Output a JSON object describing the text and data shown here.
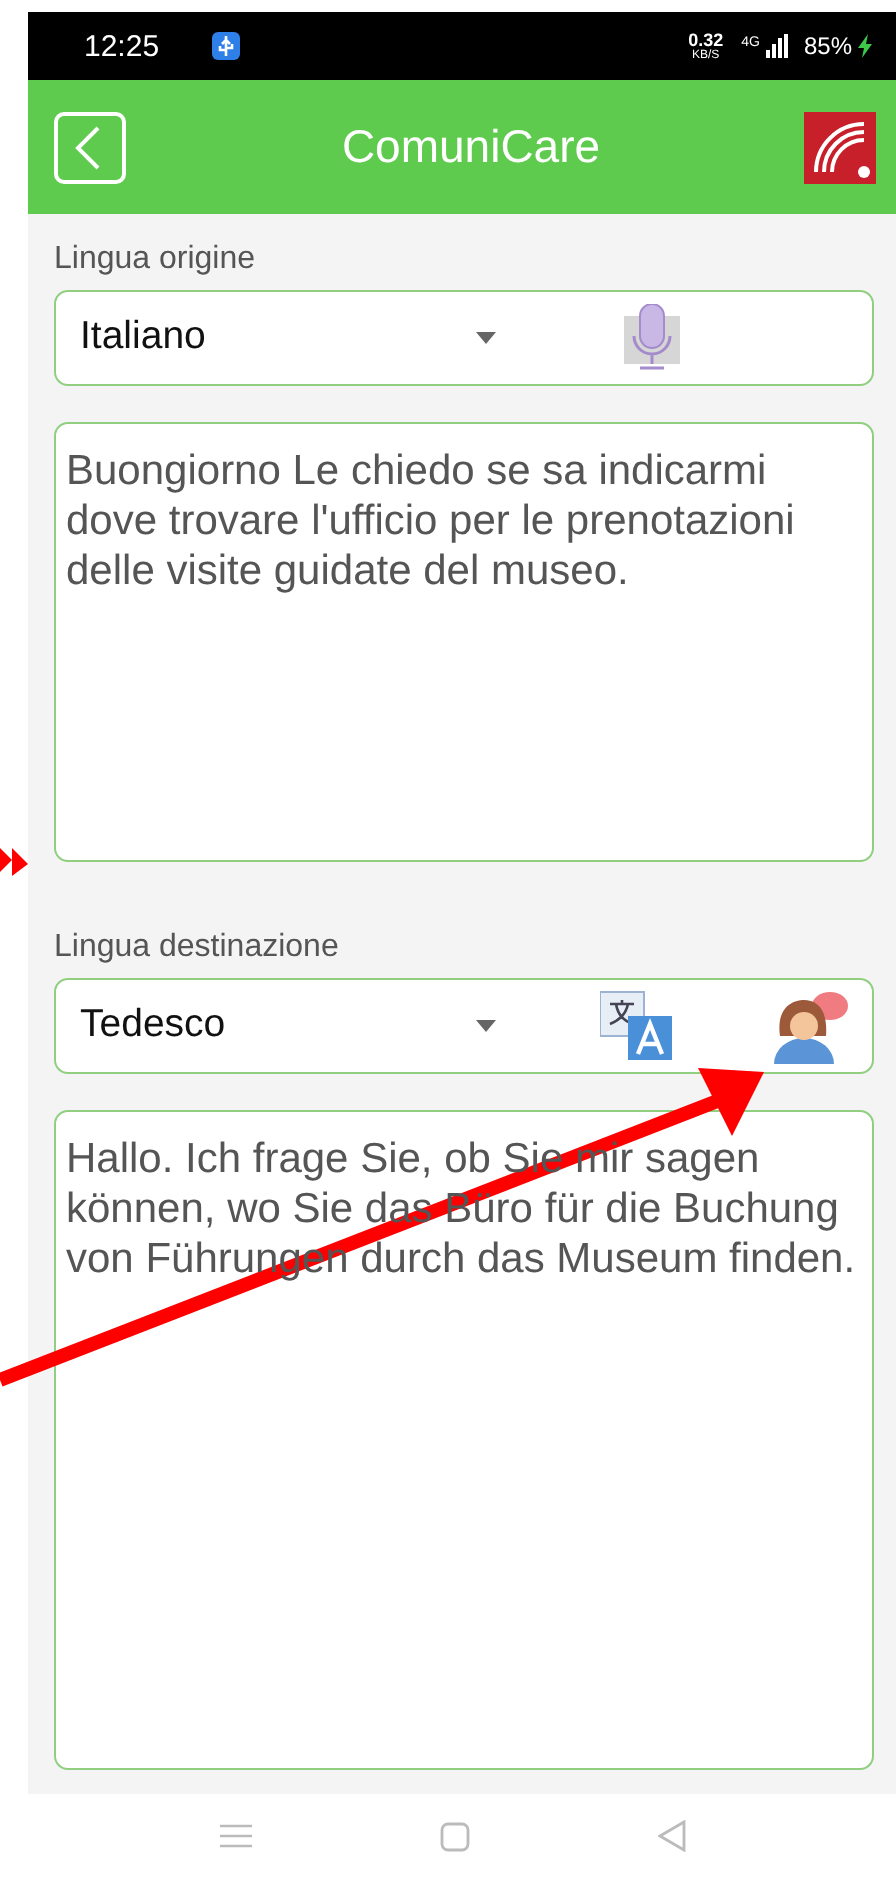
{
  "status_bar": {
    "time": "12:25",
    "speed": "0.32",
    "speed_unit": "KB/S",
    "network": "4G",
    "battery": "85%"
  },
  "header": {
    "title": "ComuniCare"
  },
  "source": {
    "label": "Lingua origine",
    "language": "Italiano",
    "text": "Buongiorno Le chiedo se sa indicarmi dove trovare l'ufficio per le prenotazioni delle visite guidate del museo."
  },
  "target": {
    "label": "Lingua destinazione",
    "language": "Tedesco",
    "text": "Hallo. Ich frage Sie, ob Sie mir sagen können, wo Sie das Büro für die Buchung von Führungen durch das Museum finden."
  }
}
